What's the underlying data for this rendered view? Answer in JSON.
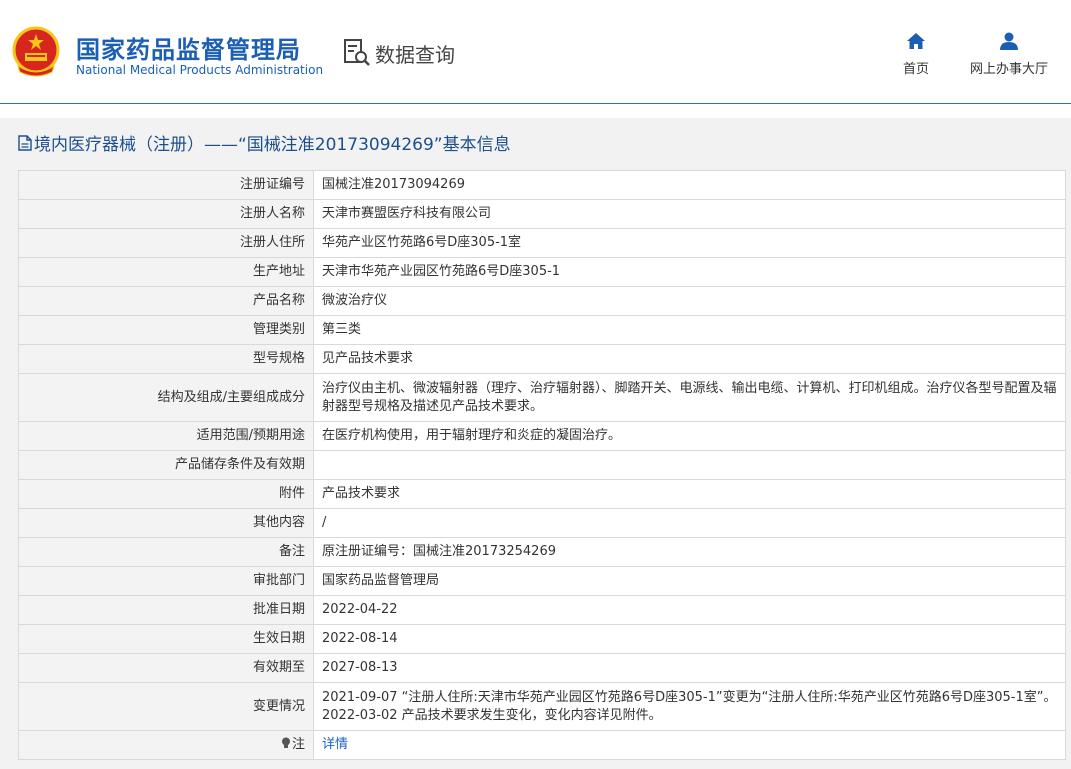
{
  "header": {
    "title_zh": "国家药品监督管理局",
    "title_en": "National Medical Products Administration",
    "query_label": "数据查询",
    "nav": [
      {
        "label": "首页",
        "icon": "home-icon"
      },
      {
        "label": "网上办事大厅",
        "icon": "user-icon"
      }
    ]
  },
  "section": {
    "title": "境内医疗器械（注册）——“国械注准20173094269”基本信息"
  },
  "rows": [
    {
      "label": "注册证编号",
      "value": "国械注准20173094269"
    },
    {
      "label": "注册人名称",
      "value": "天津市赛盟医疗科技有限公司"
    },
    {
      "label": "注册人住所",
      "value": "华苑产业区竹苑路6号D座305-1室"
    },
    {
      "label": "生产地址",
      "value": "天津市华苑产业园区竹苑路6号D座305-1"
    },
    {
      "label": "产品名称",
      "value": "微波治疗仪"
    },
    {
      "label": "管理类别",
      "value": "第三类"
    },
    {
      "label": "型号规格",
      "value": "见产品技术要求"
    },
    {
      "label": "结构及组成/主要组成成分",
      "value": "治疗仪由主机、微波辐射器（理疗、治疗辐射器）、脚踏开关、电源线、输出电缆、计算机、打印机组成。治疗仪各型号配置及辐射器型号规格及描述见产品技术要求。"
    },
    {
      "label": "适用范围/预期用途",
      "value": "在医疗机构使用，用于辐射理疗和炎症的凝固治疗。"
    },
    {
      "label": "产品储存条件及有效期",
      "value": ""
    },
    {
      "label": "附件",
      "value": "产品技术要求"
    },
    {
      "label": "其他内容",
      "value": "/"
    },
    {
      "label": "备注",
      "value": "原注册证编号：国械注准20173254269"
    },
    {
      "label": "审批部门",
      "value": "国家药品监督管理局"
    },
    {
      "label": "批准日期",
      "value": "2022-04-22"
    },
    {
      "label": "生效日期",
      "value": "2022-08-14"
    },
    {
      "label": "有效期至",
      "value": "2027-08-13"
    },
    {
      "label": "变更情况",
      "value_line1": "2021-09-07 “注册人住所:天津市华苑产业园区竹苑路6号D座305-1”变更为“注册人住所:华苑产业区竹苑路6号D座305-1室”。",
      "value_line2": "2022-03-02 产品技术要求发生变化，变化内容详见附件。"
    },
    {
      "label": "注",
      "value": "详情",
      "icon": "lightbulb-icon"
    }
  ],
  "colors": {
    "brand_blue": "#1b5fb5",
    "link": "#1a62c9",
    "emblem_red": "#d7261e",
    "emblem_gold": "#f5c518"
  }
}
